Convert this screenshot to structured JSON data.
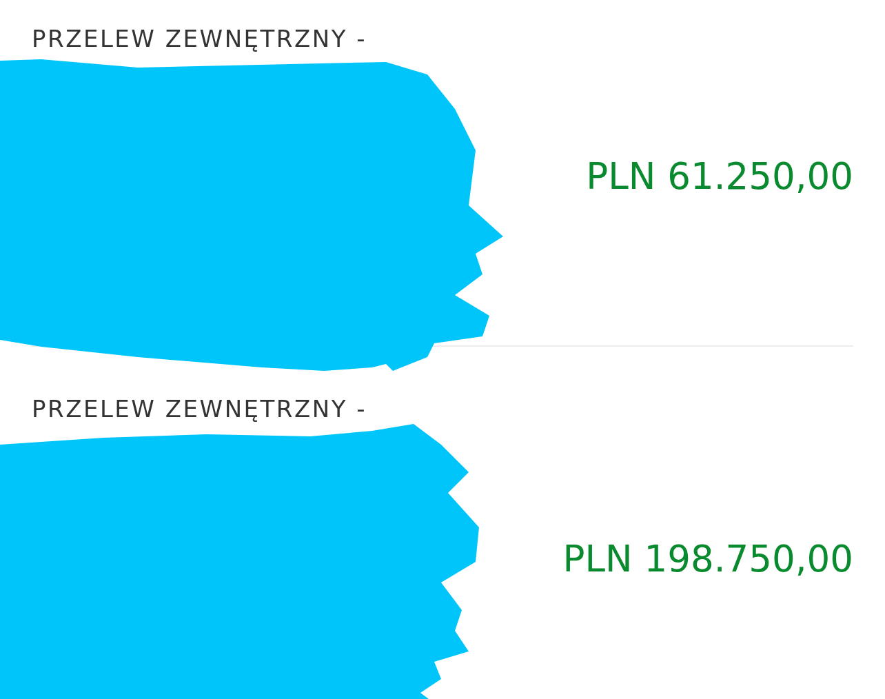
{
  "transactions": [
    {
      "title": "PRZELEW ZEWNĘTRZNY -",
      "amount": "PLN 61.250,00"
    },
    {
      "title": "PRZELEW ZEWNĘTRZNY -",
      "amount": "PLN 198.750,00"
    }
  ]
}
